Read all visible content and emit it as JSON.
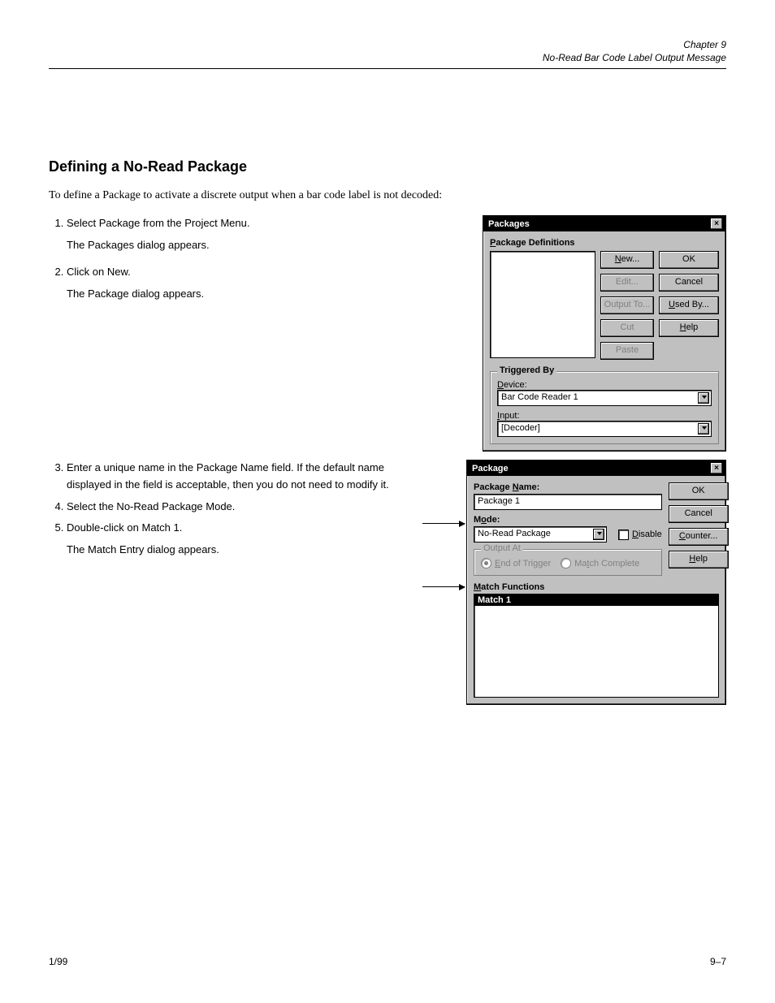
{
  "header": {
    "chapter_line1": "Chapter 9",
    "chapter_line2": "No-Read Bar Code Label Output Message"
  },
  "section_title": "Defining a No-Read Package",
  "intro_para": "To define a Package to activate a discrete output when a bar code label is not decoded:",
  "steps_a": {
    "s1": "Select Package from the Project Menu.",
    "s2": "The Packages dialog appears.",
    "s3": "Click on New.",
    "s4": "The Package dialog appears.",
    "s5": "Enter a unique name in the Package Name field. If the default name displayed in the field is acceptable, then you do not need to modify it.",
    "s6": "Select the No-Read Package Mode.",
    "s7": "Double-click on Match 1.",
    "s8": "The Match Entry dialog appears."
  },
  "dialog1": {
    "title": "Packages",
    "pkg_def_label": "Package Definitions",
    "btn_new": "New...",
    "btn_edit": "Edit...",
    "btn_output_to": "Output To...",
    "btn_cut": "Cut",
    "btn_paste": "Paste",
    "btn_ok": "OK",
    "btn_cancel": "Cancel",
    "btn_used_by": "Used By...",
    "btn_help": "Help",
    "triggered_by": "Triggered By",
    "device_label": "Device:",
    "device_value": "Bar Code Reader 1",
    "input_label": "Input:",
    "input_value": "[Decoder]"
  },
  "dialog2": {
    "title": "Package",
    "name_label": "Package Name:",
    "name_value": "Package 1",
    "mode_label": "Mode:",
    "mode_value": "No-Read Package",
    "disable_label": "Disable",
    "output_at": "Output At",
    "radio_end": "End of Trigger",
    "radio_match": "Match Complete",
    "match_functions": "Match Functions",
    "match_item": "Match 1",
    "btn_ok": "OK",
    "btn_cancel": "Cancel",
    "btn_counter": "Counter...",
    "btn_help": "Help"
  },
  "footer": {
    "left": "1/99",
    "right": "9–7"
  }
}
